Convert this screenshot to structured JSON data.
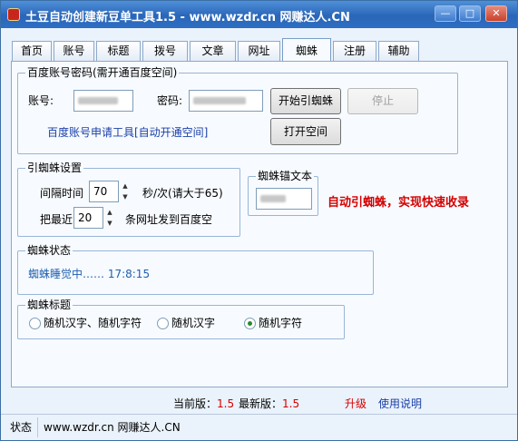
{
  "window": {
    "title": "土豆自动创建新豆单工具1.5 - www.wzdr.cn 网赚达人.CN"
  },
  "controls": {
    "minimize": "—",
    "maximize": "□",
    "close": "✕"
  },
  "tabs": [
    "首页",
    "账号",
    "标题",
    "拨号",
    "文章",
    "网址",
    "蜘蛛",
    "注册",
    "辅助"
  ],
  "active_tab": "蜘蛛",
  "baidu": {
    "legend": "百度账号密码(需开通百度空间)",
    "account_label": "账号:",
    "password_label": "密码:",
    "start_button": "开始引蜘蛛",
    "stop_button": "停止",
    "apply_link": "百度账号申请工具[自动开通空间]",
    "open_space_button": "打开空间"
  },
  "settings": {
    "legend": "引蜘蛛设置",
    "interval_label": "间隔时间",
    "interval_value": "70",
    "interval_unit": "秒/次(请大于65)",
    "recent_label": "把最近",
    "recent_value": "20",
    "recent_unit": "条网址发到百度空"
  },
  "anchor": {
    "legend": "蜘蛛锚文本"
  },
  "promo": "自动引蜘蛛，实现快速收录",
  "spider_status": {
    "legend": "蜘蛛状态",
    "text": "蜘蛛睡觉中…… 17:8:15"
  },
  "spider_title": {
    "legend": "蜘蛛标题",
    "options": [
      "随机汉字、随机字符",
      "随机汉字",
      "随机字符"
    ],
    "selected": "随机字符"
  },
  "version": {
    "current_label": "当前版：",
    "current": "1.5",
    "latest_label": "最新版：",
    "latest": "1.5",
    "upgrade": "升级",
    "help": "使用说明"
  },
  "statusbar": {
    "label": "状态",
    "text": "www.wzdr.cn 网赚达人.CN"
  },
  "colors": {
    "accent_red": "#d40000",
    "link_blue": "#1a3fa8",
    "status_blue": "#1f5fb0"
  }
}
